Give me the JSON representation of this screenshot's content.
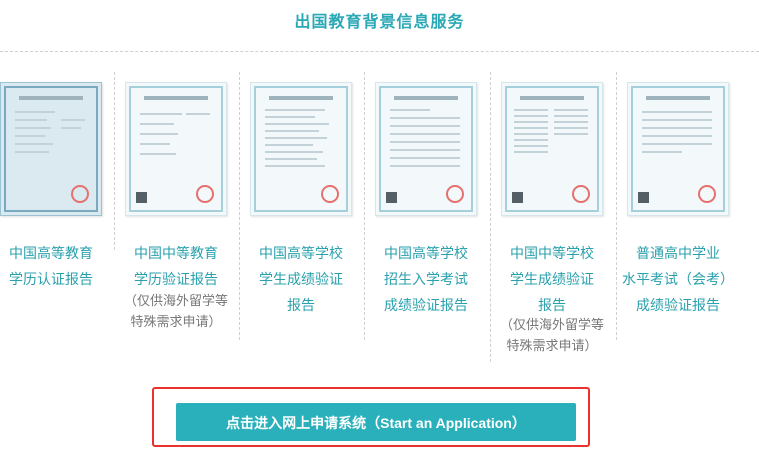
{
  "header": {
    "title": "出国教育背景信息服务"
  },
  "reports": [
    {
      "line1": "中国高等教育",
      "line2": "学历认证报告",
      "line3": "",
      "note1": "",
      "note2": ""
    },
    {
      "line1": "中国中等教育",
      "line2": "学历验证报告",
      "line3": "",
      "note1": "（仅供海外留学等",
      "note2": "特殊需求申请）"
    },
    {
      "line1": "中国高等学校",
      "line2": "学生成绩验证",
      "line3": "报告",
      "note1": "",
      "note2": ""
    },
    {
      "line1": "中国高等学校",
      "line2": "招生入学考试",
      "line3": "成绩验证报告",
      "note1": "",
      "note2": ""
    },
    {
      "line1": "中国中等学校",
      "line2": "学生成绩验证",
      "line3": "报告",
      "note1": "（仅供海外留学等",
      "note2": "特殊需求申请）"
    },
    {
      "line1": "普通高中学业",
      "line2": "水平考试（会考）",
      "line3": "成绩验证报告",
      "note1": "",
      "note2": ""
    }
  ],
  "action": {
    "apply_label": "点击进入网上申请系统（Start an Application）"
  },
  "colors": {
    "accent": "#29b0bb",
    "title": "#2aa8b5",
    "highlight": "#e8322b",
    "note": "#777777"
  }
}
